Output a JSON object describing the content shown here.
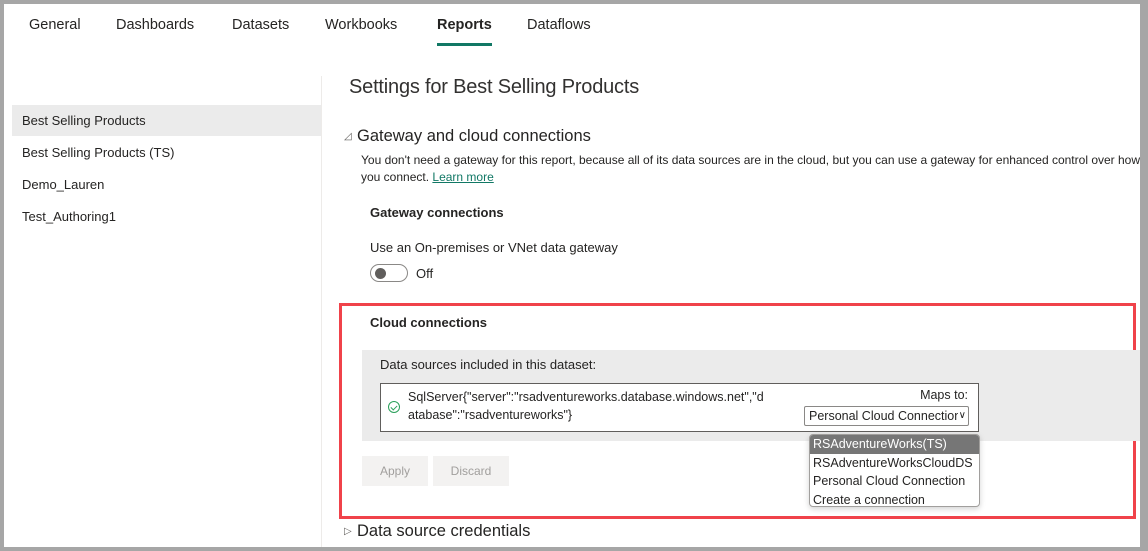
{
  "tabs": [
    {
      "label": "General",
      "active": false
    },
    {
      "label": "Dashboards",
      "active": false
    },
    {
      "label": "Datasets",
      "active": false
    },
    {
      "label": "Workbooks",
      "active": false
    },
    {
      "label": "Reports",
      "active": true
    },
    {
      "label": "Dataflows",
      "active": false
    }
  ],
  "accent_color": "#117865",
  "sidebar": {
    "items": [
      {
        "label": "Best Selling Products",
        "selected": true
      },
      {
        "label": "Best Selling Products (TS)",
        "selected": false
      },
      {
        "label": "Demo_Lauren",
        "selected": false
      },
      {
        "label": "Test_Authoring1",
        "selected": false
      }
    ]
  },
  "main": {
    "title": "Settings for Best Selling Products",
    "gateway_section": {
      "title": "Gateway and cloud connections",
      "expanded_icon": "triangle-down-icon",
      "description": "You don't need a gateway for this report, because all of its data sources are in the cloud, but you can use a gateway for enhanced control over how you connect.",
      "learn_more": "Learn more",
      "gateway_connections": {
        "heading": "Gateway connections",
        "toggle_label": "Use an On-premises or VNet data gateway",
        "toggle_state": "Off"
      },
      "cloud_connections": {
        "heading": "Cloud connections",
        "panel_label": "Data sources included in this dataset:",
        "data_source": "SqlServer{\"server\":\"rsadventureworks.database.windows.net\",\"database\":\"rsadventureworks\"}",
        "status_icon": "check-circle-icon",
        "maps_to_label": "Maps to:",
        "selected_value": "Personal Cloud Connection",
        "options": [
          {
            "label": "RSAdventureWorks(TS)",
            "highlighted": true
          },
          {
            "label": "RSAdventureWorksCloudDS",
            "highlighted": false
          },
          {
            "label": "Personal Cloud Connection",
            "highlighted": false
          },
          {
            "label": "Create a connection",
            "highlighted": false
          }
        ],
        "apply_label": "Apply",
        "discard_label": "Discard",
        "highlight_color": "#f0424a"
      }
    },
    "credentials_section": {
      "title": "Data source credentials",
      "collapsed_icon": "triangle-right-icon"
    }
  }
}
